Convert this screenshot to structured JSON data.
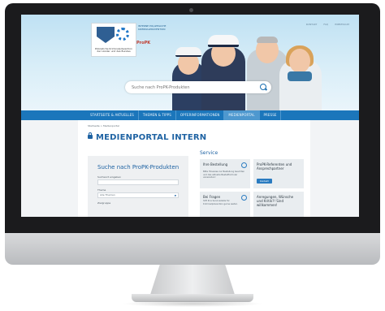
{
  "site": {
    "toplinks": [
      "KONTAKT",
      "FAQ",
      "IMPRESSUM"
    ],
    "logo_caption": "Polizeiliche Kriminalprävention der Länder und des Bundes",
    "logo2_text": "INTERNE POLIZEILICHE KRIMINALPRÄVENTION",
    "logo3_text": "ProPK"
  },
  "search": {
    "placeholder": "Suche nach ProPK-Produkten",
    "icon": "search-icon"
  },
  "nav": {
    "items": [
      "STARTSEITE & AKTUELLES",
      "THEMEN & TIPPS",
      "OPFERINFORMATIONEN",
      "MEDIENPORTAL",
      "PRESSE"
    ],
    "active_index": 3
  },
  "breadcrumb": {
    "text": "Startseite > Medienportal"
  },
  "page": {
    "title": "MEDIENPORTAL INTERN",
    "title_icon": "lock-icon"
  },
  "product_search": {
    "heading": "Suche nach ProPK-Produkten",
    "field1_label": "Suchwort eingeben",
    "field2_label": "Thema",
    "field2_value": "Alle Themen",
    "field3_label": "Zielgruppe"
  },
  "service": {
    "heading": "Service",
    "cards": [
      {
        "title": "Ihre Bestellung",
        "body": "Bitte Hinweise zur Bestellung beachten und das aktuelle Bestellformular verwenden!",
        "icon": "cart-icon"
      },
      {
        "title": "ProPK-Referenten und Ansprechpartner",
        "body": "",
        "button": "Kontakt",
        "icon": ""
      },
      {
        "title": "Bei Fragen",
        "body": "hilft Ihre Servicestelle für Kriminalprävention gerne weiter.",
        "icon": "question-icon"
      },
      {
        "title": "Anregungen, Wünsche und Kritik?! Sind willkommen!",
        "body": "",
        "icon": ""
      }
    ]
  },
  "colors": {
    "brand_blue": "#1b76bb",
    "title_blue": "#1f63a3"
  }
}
